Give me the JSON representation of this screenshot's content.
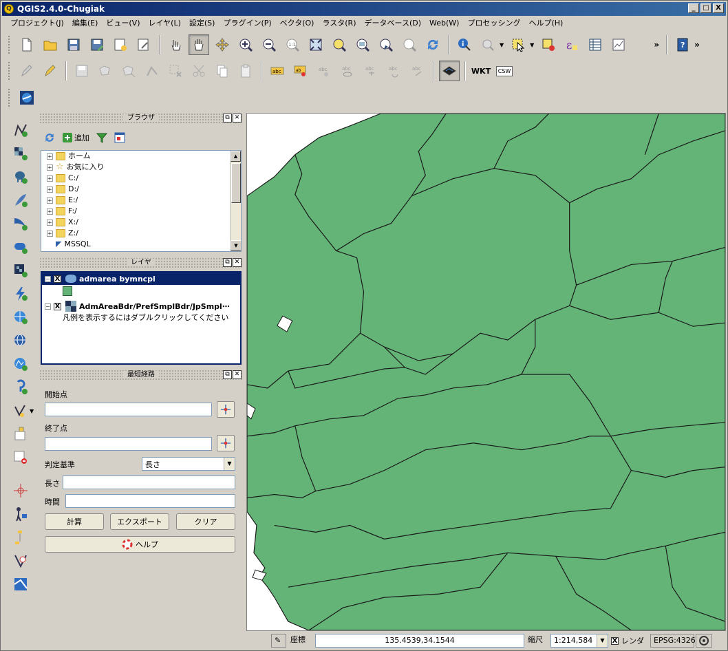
{
  "window": {
    "title": "QGIS2.4.0-Chugiak",
    "app_icon_glyph": "Q",
    "controls": [
      "_",
      "□",
      "X"
    ]
  },
  "menu": [
    "プロジェクト(J)",
    "編集(E)",
    "ビュー(V)",
    "レイヤ(L)",
    "設定(S)",
    "プラグイン(P)",
    "ベクタ(O)",
    "ラスタ(R)",
    "データベース(D)",
    "Web(W)",
    "プロセッシング",
    "ヘルプ(H)"
  ],
  "toolbar": {
    "overflow_label": "»",
    "wkt_label": "WKT",
    "csw_label": "CSW"
  },
  "browser_panel": {
    "title": "ブラウザ",
    "add_label": "追加",
    "items": [
      "ホーム",
      "お気に入り",
      "C:/",
      "D:/",
      "E:/",
      "F:/",
      "X:/",
      "Z:/",
      "MSSQL"
    ]
  },
  "layers_panel": {
    "title": "レイヤ",
    "layers": [
      {
        "name": "admarea bymncpl",
        "selected": true,
        "checked": "X"
      },
      {
        "name": "AdmAreaBdr/PrefSmplBdr/JpSmpl⋯",
        "selected": false,
        "checked": "X"
      }
    ],
    "legend_hint": "凡例を表示するにはダブルクリックしてください"
  },
  "route_panel": {
    "title": "最短経路",
    "start_label": "開始点",
    "end_label": "終了点",
    "criterion_label": "判定基準",
    "criterion_value": "長さ",
    "length_label": "長さ",
    "time_label": "時間",
    "calc_button": "計算",
    "export_button": "エクスポート",
    "clear_button": "クリア",
    "help_button": "ヘルプ"
  },
  "status": {
    "coord_label": "座標",
    "coord_value": "135.4539,34.1544",
    "scale_label": "縮尺",
    "scale_value": "1:214,584",
    "render_label": "レンダ",
    "render_checked": "X",
    "crs": "EPSG:4326"
  },
  "colors": {
    "map_fill": "#63b476",
    "map_stroke": "#1a1a1a",
    "selection": "#0a246a"
  }
}
